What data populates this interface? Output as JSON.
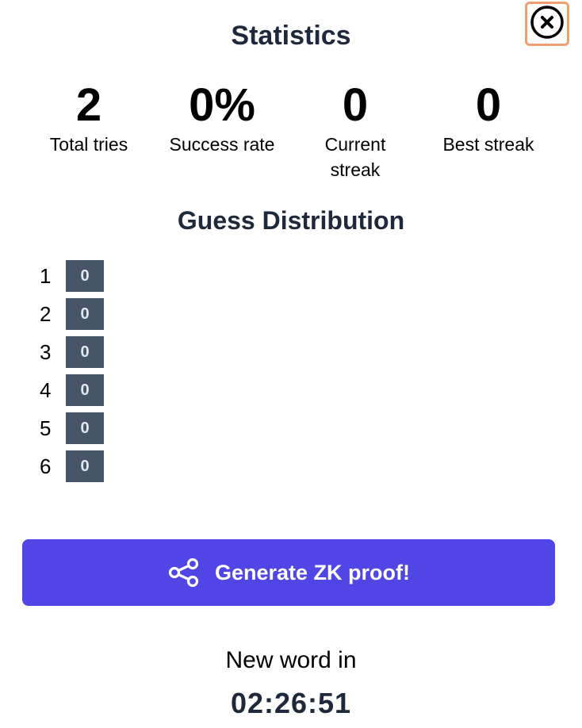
{
  "modal": {
    "title": "Statistics",
    "close_icon": "close-circle-icon"
  },
  "stats": [
    {
      "value": "2",
      "label": "Total tries"
    },
    {
      "value": "0%",
      "label": "Success rate"
    },
    {
      "value": "0",
      "label": "Current streak"
    },
    {
      "value": "0",
      "label": "Best streak"
    }
  ],
  "distribution": {
    "title": "Guess Distribution",
    "rows": [
      {
        "guess": "1",
        "count": "0"
      },
      {
        "guess": "2",
        "count": "0"
      },
      {
        "guess": "3",
        "count": "0"
      },
      {
        "guess": "4",
        "count": "0"
      },
      {
        "guess": "5",
        "count": "0"
      },
      {
        "guess": "6",
        "count": "0"
      }
    ]
  },
  "actions": {
    "generate_label": "Generate ZK proof!",
    "generate_icon": "share-icon"
  },
  "countdown": {
    "label": "New word in",
    "time": "02:26:51"
  },
  "colors": {
    "button_bg": "#4f46e5",
    "bar_bg": "#475569",
    "close_outline": "#f0a070"
  }
}
